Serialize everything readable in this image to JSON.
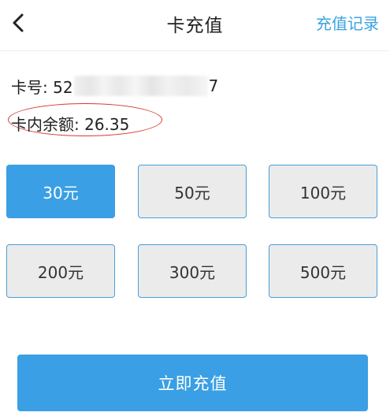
{
  "header": {
    "title": "卡充值",
    "records_label": "充值记录"
  },
  "card": {
    "number_prefix": "卡号: 52",
    "number_suffix": "7",
    "balance_text": "卡内余额: 26.35"
  },
  "amounts": [
    {
      "label": "30元",
      "selected": true
    },
    {
      "label": "50元",
      "selected": false
    },
    {
      "label": "100元",
      "selected": false
    },
    {
      "label": "200元",
      "selected": false
    },
    {
      "label": "300元",
      "selected": false
    },
    {
      "label": "500元",
      "selected": false
    }
  ],
  "submit": {
    "label": "立即充值"
  },
  "colors": {
    "accent": "#3a9fe4",
    "link": "#3aa3e0",
    "highlight_circle": "#d43b34"
  }
}
